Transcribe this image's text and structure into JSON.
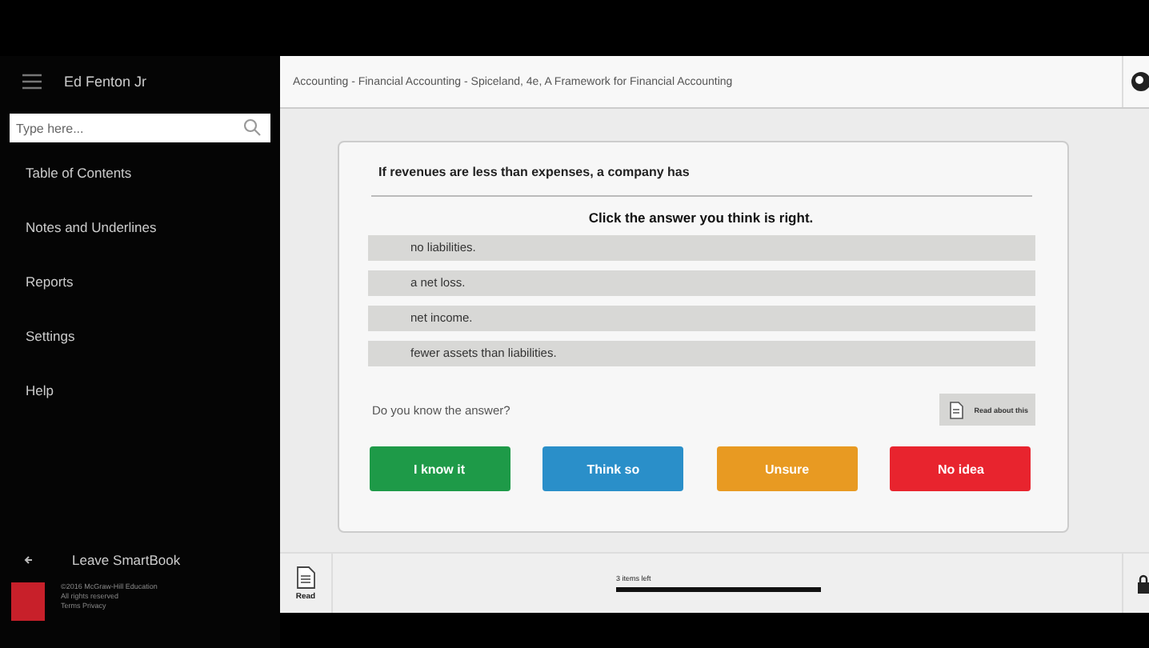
{
  "sidebar": {
    "user": "Ed Fenton Jr",
    "search": {
      "placeholder": "Type here..."
    },
    "items": [
      {
        "label": "Table of Contents"
      },
      {
        "label": "Notes and Underlines"
      },
      {
        "label": "Reports"
      },
      {
        "label": "Settings"
      },
      {
        "label": "Help"
      }
    ],
    "leave": "Leave SmartBook",
    "footer": [
      "©2016 McGraw-Hill Education",
      "All rights reserved",
      "Terms  Privacy"
    ]
  },
  "header": {
    "title": "Accounting - Financial Accounting - Spiceland, 4e, A Framework for Financial Accounting"
  },
  "question": {
    "text": "If revenues are less than expenses, a company has",
    "instruction": "Click the answer you think is right.",
    "options": [
      {
        "label": "no liabilities."
      },
      {
        "label": "a net loss."
      },
      {
        "label": "net income."
      },
      {
        "label": "fewer assets than liabilities."
      }
    ],
    "prompt": "Do you know the answer?",
    "read_about": "Read about this",
    "confidence": [
      {
        "label": "I know it",
        "color": "#1e9a48"
      },
      {
        "label": "Think so",
        "color": "#2a8fc9"
      },
      {
        "label": "Unsure",
        "color": "#e89a22"
      },
      {
        "label": "No idea",
        "color": "#e8242e"
      }
    ]
  },
  "bottom_bar": {
    "read": "Read",
    "progress_text": "3 items left",
    "level": 1
  }
}
